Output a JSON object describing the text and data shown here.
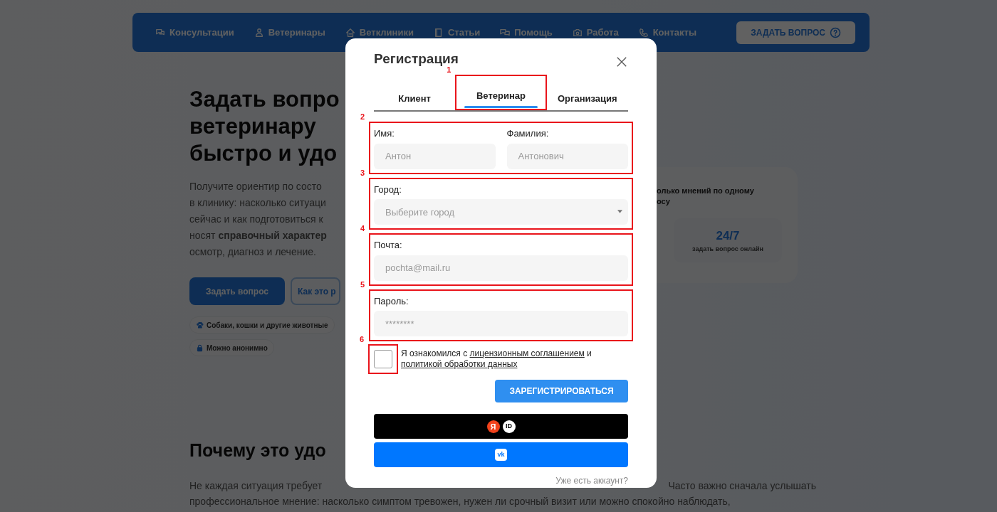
{
  "nav": {
    "items": [
      {
        "label": "Консультации"
      },
      {
        "label": "Ветеринары"
      },
      {
        "label": "Ветклиники"
      },
      {
        "label": "Статьи"
      },
      {
        "label": "Помощь"
      },
      {
        "label": "Работа"
      },
      {
        "label": "Контакты"
      }
    ],
    "ask_button": "ЗАДАТЬ ВОПРОС"
  },
  "hero": {
    "heading_lines": [
      "Задать вопро",
      "ветеринару",
      "быстро и удо"
    ],
    "text_lines": [
      "Получите ориентир по состо",
      "в клинику: насколько ситуаци",
      "сейчас и как подготовиться к",
      "носят **справочный характер**",
      "осмотр, диагноз и лечение."
    ],
    "buttons": [
      {
        "label": "Задать вопрос",
        "kind": "primary"
      },
      {
        "label": "Как это р",
        "kind": "outline"
      }
    ],
    "chips": [
      {
        "label": "Собаки, кошки и другие животные"
      },
      {
        "label": "Можно анонимно"
      }
    ]
  },
  "stats_card": {
    "text_lines": [
      "олько мнений по одному",
      "осу"
    ],
    "stat": {
      "value": "24/7",
      "caption": "задать вопрос онлайн"
    }
  },
  "why": {
    "heading": "Почему это удо",
    "line_1_left": "Не каждая ситуация требует",
    "line_1_right": "Часто важно сначала услышать",
    "line_2": "профессиональное мнение: насколько симптом тревожен, нужен ли срочный визит или можно спокойно наблюдать,"
  },
  "modal": {
    "title": "Регистрация",
    "tabs": [
      {
        "label": "Клиент",
        "selected": false
      },
      {
        "label": "Ветеринар",
        "selected": true,
        "annotation": "1"
      },
      {
        "label": "Организация",
        "selected": false
      }
    ],
    "groups": [
      {
        "annotation": "2",
        "fields": [
          {
            "label": "Имя:",
            "placeholder": "Антон",
            "kind": "text"
          },
          {
            "label": "Фамилия:",
            "placeholder": "Антонович",
            "kind": "text"
          }
        ]
      },
      {
        "annotation": "3",
        "fields": [
          {
            "label": "Город:",
            "placeholder": "Выберите город",
            "kind": "select"
          }
        ]
      },
      {
        "annotation": "4",
        "fields": [
          {
            "label": "Почта:",
            "placeholder": "pochta@mail.ru",
            "kind": "text"
          }
        ]
      },
      {
        "annotation": "5",
        "fields": [
          {
            "label": "Пароль:",
            "placeholder": "********",
            "kind": "password"
          }
        ]
      }
    ],
    "consent": {
      "checked": false,
      "annotation": "6",
      "parts": [
        {
          "kind": "text",
          "text": "Я ознакомился с "
        },
        {
          "kind": "link",
          "text": "лицензионным соглашением"
        },
        {
          "kind": "text",
          "text": " и "
        },
        {
          "kind": "link",
          "text": "политикой обработки данных"
        }
      ]
    },
    "register_button": "ЗАРЕГИСТРИРОВАТЬСЯ",
    "yandex_button": {
      "badge": "Я",
      "label": "ID"
    },
    "vk_button": {
      "label": "vk"
    },
    "login_link": "Уже есть аккаунт?"
  }
}
